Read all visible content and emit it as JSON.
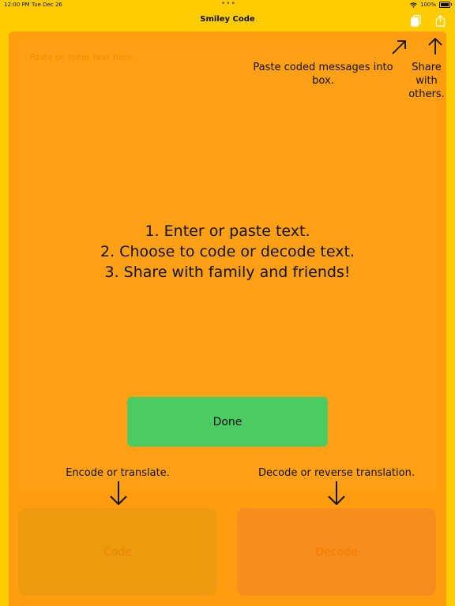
{
  "status_bar": {
    "time": "12:00 PM",
    "date": "Tue Dec 26",
    "dots": "•••",
    "battery": "100%",
    "wifi_icon": "wifi-icon"
  },
  "navbar": {
    "title": "Smiley Code",
    "paste_icon": "paste-icon",
    "share_icon": "share-icon"
  },
  "editor": {
    "placeholder": "Paste or enter text here."
  },
  "hints": {
    "paste": "Paste coded messages into box.",
    "share_line1": "Share",
    "share_line2": "with",
    "share_line3": "others.",
    "encode": "Encode or translate.",
    "decode": "Decode or reverse translation."
  },
  "instructions": {
    "line1": "1. Enter or paste text.",
    "line2": "2. Choose to code or decode text.",
    "line3": "3. Share with family and friends!"
  },
  "buttons": {
    "done": "Done",
    "code": "Code",
    "decode": "Decode"
  },
  "colors": {
    "background": "#FFCC00",
    "panel": "#FF9C10",
    "done": "#4CCB63",
    "code": "#EE9A0E",
    "decode": "#F68D1C"
  }
}
